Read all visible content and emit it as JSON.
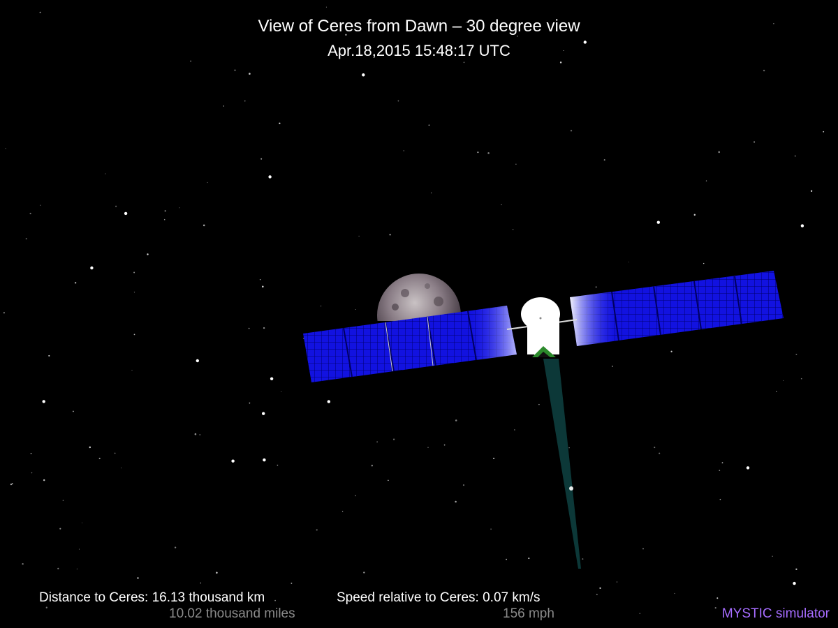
{
  "header": {
    "title": "View of Ceres from Dawn – 30 degree view",
    "timestamp": "Apr.18,2015 15:48:17  UTC"
  },
  "hud": {
    "distance": "Distance to Ceres: 16.13 thousand km",
    "distance_miles": "10.02 thousand miles",
    "speed": "Speed relative to Ceres: 0.07 km/s",
    "speed_mph": "156 mph"
  },
  "brand": {
    "label": "MYSTIC simulator",
    "color": "#a66cff"
  },
  "icons": [
    "ceres-planet-icon",
    "dawn-spacecraft-icon",
    "ion-thruster-beam-icon",
    "solar-panel-icon"
  ],
  "colors": {
    "panel_blue": "#1010e0",
    "thruster_beam": "#0c3838",
    "background": "#000000"
  }
}
